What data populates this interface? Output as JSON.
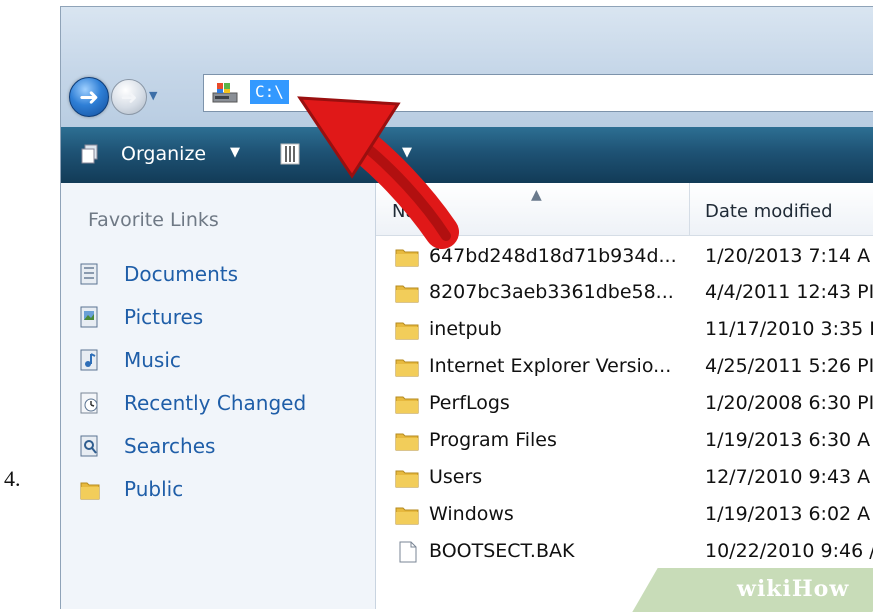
{
  "step_number": "4.",
  "address_bar": {
    "path": "C:\\"
  },
  "toolbar": {
    "organize_label": "Organize"
  },
  "sidebar": {
    "heading": "Favorite Links",
    "items": [
      {
        "label": "Documents",
        "icon": "documents-icon"
      },
      {
        "label": "Pictures",
        "icon": "pictures-icon"
      },
      {
        "label": "Music",
        "icon": "music-icon"
      },
      {
        "label": "Recently Changed",
        "icon": "recently-changed-icon"
      },
      {
        "label": "Searches",
        "icon": "searches-icon"
      },
      {
        "label": "Public",
        "icon": "folder-icon"
      }
    ]
  },
  "columns": {
    "name": "Name",
    "date": "Date modified"
  },
  "files": [
    {
      "name": "647bd248d18d71b934d...",
      "date": "1/20/2013 7:14 A",
      "icon": "folder-icon"
    },
    {
      "name": "8207bc3aeb3361dbe58...",
      "date": "4/4/2011 12:43 PI",
      "icon": "folder-icon"
    },
    {
      "name": "inetpub",
      "date": "11/17/2010 3:35 I",
      "icon": "folder-icon"
    },
    {
      "name": "Internet Explorer Versio...",
      "date": "4/25/2011 5:26 PI",
      "icon": "folder-icon"
    },
    {
      "name": "PerfLogs",
      "date": "1/20/2008 6:30 PI",
      "icon": "folder-icon"
    },
    {
      "name": "Program Files",
      "date": "1/19/2013 6:30 A",
      "icon": "folder-icon"
    },
    {
      "name": "Users",
      "date": "12/7/2010 9:43 A",
      "icon": "folder-icon"
    },
    {
      "name": "Windows",
      "date": "1/19/2013 6:02 A",
      "icon": "folder-icon"
    },
    {
      "name": "BOOTSECT.BAK",
      "date": "10/22/2010 9:46 /",
      "icon": "file-icon"
    }
  ],
  "watermark": "wikiHow",
  "colors": {
    "toolbar": "#1e5274",
    "link": "#1f5ea8",
    "selection": "#3399ff",
    "arrow": "#e01818"
  }
}
